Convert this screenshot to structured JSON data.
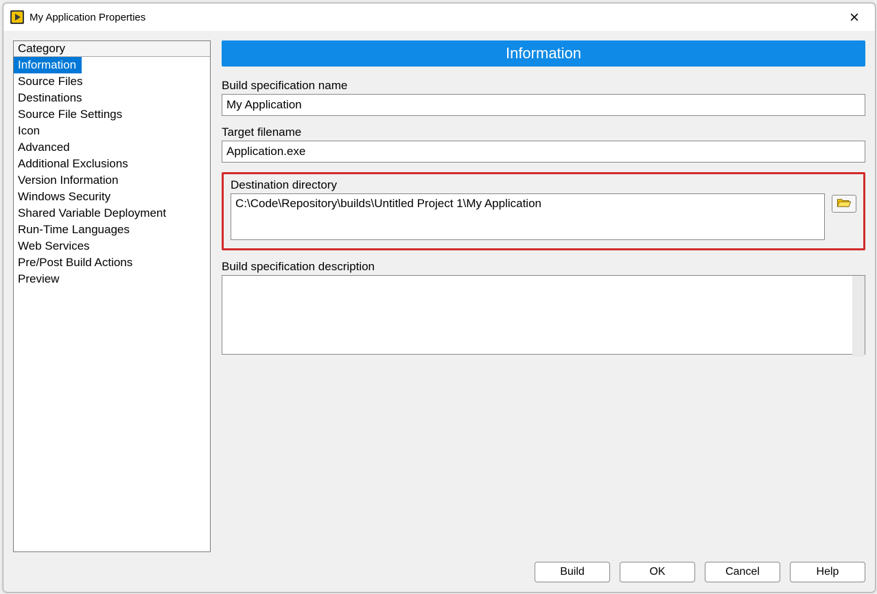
{
  "window": {
    "title": "My Application Properties"
  },
  "sidebar": {
    "header": "Category",
    "items": [
      "Information",
      "Source Files",
      "Destinations",
      "Source File Settings",
      "Icon",
      "Advanced",
      "Additional Exclusions",
      "Version Information",
      "Windows Security",
      "Shared Variable Deployment",
      "Run-Time Languages",
      "Web Services",
      "Pre/Post Build Actions",
      "Preview"
    ],
    "selected_index": 0
  },
  "page": {
    "banner": "Information",
    "build_spec_name_label": "Build specification name",
    "build_spec_name_value": "My Application",
    "target_filename_label": "Target filename",
    "target_filename_value": "Application.exe",
    "destination_directory_label": "Destination directory",
    "destination_directory_value": "C:\\Code\\Repository\\builds\\Untitled Project 1\\My Application",
    "build_spec_description_label": "Build specification description",
    "build_spec_description_value": ""
  },
  "footer": {
    "build": "Build",
    "ok": "OK",
    "cancel": "Cancel",
    "help": "Help"
  }
}
